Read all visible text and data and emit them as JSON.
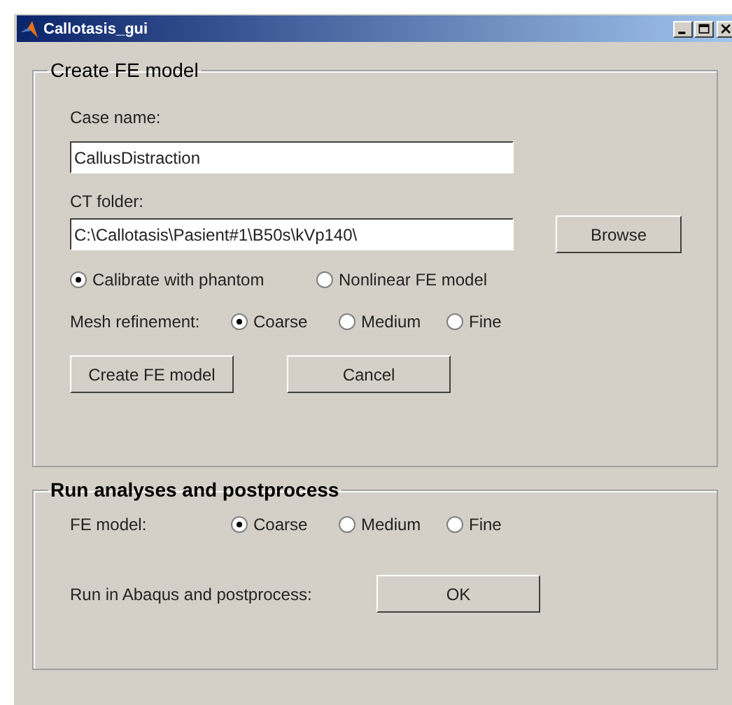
{
  "window": {
    "title": "Callotasis_gui"
  },
  "create_panel": {
    "title": "Create FE model",
    "case_name": {
      "label": "Case name:",
      "value": "CallusDistraction"
    },
    "ct_folder": {
      "label": "CT folder:",
      "value": "C:\\Callotasis\\Pasient#1\\B50s\\kVp140\\",
      "button": "Browse"
    },
    "method": [
      {
        "label": "Calibrate with phantom",
        "selected": true
      },
      {
        "label": "Nonlinear FE model",
        "selected": false
      }
    ],
    "mesh": {
      "label": "Mesh refinement:",
      "options": [
        {
          "label": "Coarse",
          "selected": true
        },
        {
          "label": "Medium",
          "selected": false
        },
        {
          "label": "Fine",
          "selected": false
        }
      ]
    },
    "buttons": [
      "Create FE model",
      "Cancel"
    ]
  },
  "run_panel": {
    "title": "Run analyses and postprocess",
    "fe_model": {
      "label": "FE model:",
      "options": [
        {
          "label": "Coarse",
          "selected": true
        },
        {
          "label": "Medium",
          "selected": false
        },
        {
          "label": "Fine",
          "selected": false
        }
      ]
    },
    "run": {
      "label": "Run in Abaqus and postprocess:",
      "button": "OK"
    }
  }
}
